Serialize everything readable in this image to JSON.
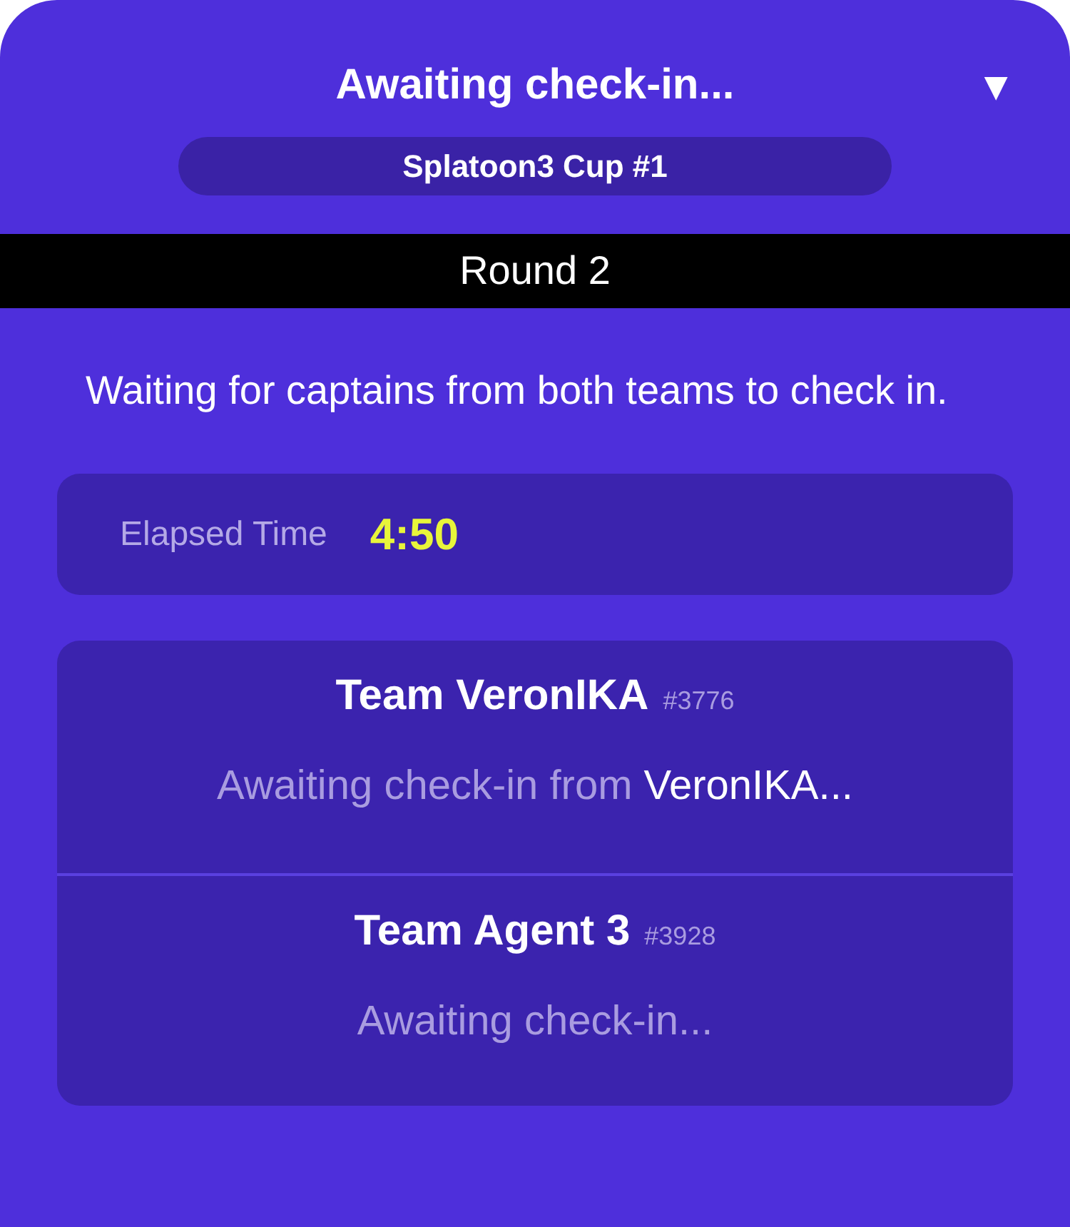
{
  "header": {
    "title": "Awaiting check-in...",
    "toggle": "▼",
    "event": "Splatoon3 Cup #1"
  },
  "round": "Round 2",
  "message": "Waiting for captains from both teams to check in.",
  "timer": {
    "label": "Elapsed Time",
    "value": "4:50"
  },
  "teams": [
    {
      "name": "Team VeronIKA",
      "number": "#3776",
      "status": "Awaiting check-in from",
      "captain": "VeronIKA..."
    },
    {
      "name": "Team Agent 3",
      "number": "#3928",
      "status": "Awaiting check-in..."
    }
  ]
}
